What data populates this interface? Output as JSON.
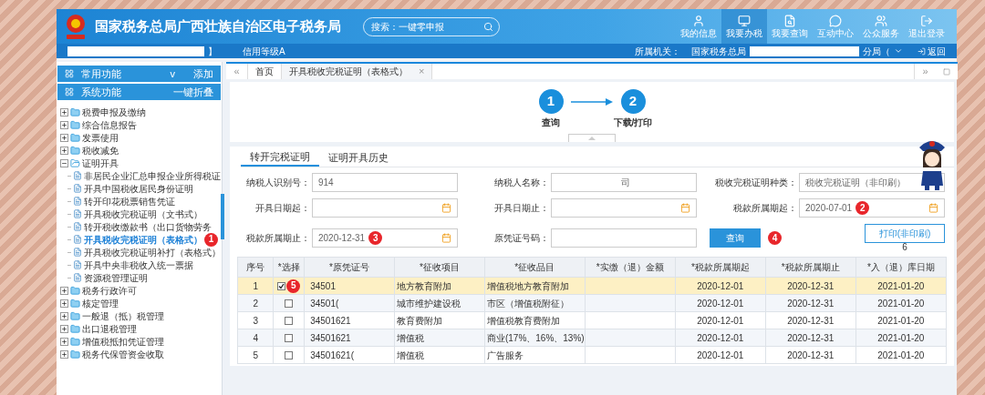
{
  "header": {
    "title": "国家税务总局广西壮族自治区电子税务局",
    "search_placeholder": "搜索：一键零申报",
    "nav": [
      {
        "kind": "user",
        "label": "我的信息",
        "selected": false
      },
      {
        "kind": "monitor",
        "label": "我要办税",
        "selected": true
      },
      {
        "kind": "search",
        "label": "我要查询",
        "selected": false
      },
      {
        "kind": "chat",
        "label": "互动中心",
        "selected": false
      },
      {
        "kind": "people",
        "label": "公众服务",
        "selected": false
      },
      {
        "kind": "logout",
        "label": "退出登录",
        "selected": false
      }
    ]
  },
  "subbar": {
    "bracket": "】",
    "credit": "信用等级A",
    "org_label": "所属机关：",
    "org": "国家税务总局",
    "org_suffix": "分局（",
    "back": "返回"
  },
  "sidebar": {
    "sections": [
      {
        "label": "常用功能",
        "caret": "v",
        "action": "添加"
      },
      {
        "label": "系统功能",
        "action": "一键折叠"
      }
    ],
    "tree": [
      {
        "label": "税费申报及缴纳",
        "expanded": false
      },
      {
        "label": "综合信息报告",
        "expanded": false
      },
      {
        "label": "发票使用",
        "expanded": false
      },
      {
        "label": "税收减免",
        "expanded": false
      },
      {
        "label": "证明开具",
        "expanded": true,
        "children": [
          {
            "label": "非居民企业汇总申报企业所得税证",
            "selected": false
          },
          {
            "label": "开具中国税收居民身份证明",
            "selected": false
          },
          {
            "label": "转开印花税票销售凭证",
            "selected": false
          },
          {
            "label": "开具税收完税证明（文书式）",
            "selected": false
          },
          {
            "label": "转开税收缴款书（出口货物劳务",
            "selected": false
          },
          {
            "label": "开具税收完税证明（表格式）",
            "selected": true,
            "callout": "1"
          },
          {
            "label": "开具税收完税证明补打（表格式）",
            "selected": false
          },
          {
            "label": "开具中央非税收入统一票据",
            "selected": false
          },
          {
            "label": "资源税管理证明",
            "selected": false
          }
        ]
      },
      {
        "label": "税务行政许可",
        "expanded": false
      },
      {
        "label": "核定管理",
        "expanded": false
      },
      {
        "label": "一般退（抵）税管理",
        "expanded": false
      },
      {
        "label": "出口退税管理",
        "expanded": false
      },
      {
        "label": "增值税抵扣凭证管理",
        "expanded": false
      },
      {
        "label": "税务代保管资金收取",
        "expanded": false
      }
    ]
  },
  "page_tabs": {
    "prev": "«",
    "next": "»",
    "tabs": [
      {
        "label": "首页",
        "selected": false,
        "closable": false
      },
      {
        "label": "开具税收完税证明（表格式）",
        "selected": true,
        "closable": true,
        "close": "×"
      }
    ]
  },
  "steps": [
    {
      "number": "1",
      "label": "查询"
    },
    {
      "number": "2",
      "label": "下载/打印"
    }
  ],
  "form": {
    "tabs": [
      {
        "label": "转开完税证明",
        "selected": true
      },
      {
        "label": "证明开具历史",
        "selected": false
      }
    ],
    "fields": [
      {
        "label": "纳税人识别号：",
        "value": "914",
        "date": false
      },
      {
        "label": "纳税人名称：",
        "suffix": "司",
        "date": false
      },
      {
        "label": "税收完税证明种类：",
        "value": "税收完税证明（非印刷）",
        "date": false
      },
      {
        "label": "开具日期起：",
        "date": true
      },
      {
        "label": "开具日期止：",
        "date": true
      },
      {
        "label": "税款所属期起：",
        "value": "2020-07-01",
        "date": true,
        "callout": "2"
      },
      {
        "label": "税款所属期止：",
        "value": "2020-12-31",
        "date": true,
        "callout": "3"
      },
      {
        "label": "原凭证号码：",
        "date": false
      }
    ],
    "query_button": {
      "label": "查询",
      "callout": "4"
    },
    "print_button": {
      "label": "打印(非印刷)",
      "note": "6"
    }
  },
  "table": {
    "columns": [
      "序号",
      "*选择",
      "*原凭证号",
      "*征收项目",
      "*征收品目",
      "*实缴（退）金额",
      "*税款所属期起",
      "*税款所属期止",
      "*入（退）库日期"
    ],
    "rows": [
      {
        "no": "1",
        "checked": true,
        "selected": true,
        "callout": "5",
        "voucher": "34501",
        "item": "地方教育附加",
        "subitem": "增值税地方教育附加",
        "start": "2020-12-01",
        "end": "2020-12-31",
        "date": "2021-01-20"
      },
      {
        "no": "2",
        "checked": false,
        "selected": false,
        "voucher": "34501(",
        "item": "城市维护建设税",
        "subitem": "市区（增值税附征）",
        "start": "2020-12-01",
        "end": "2020-12-31",
        "date": "2021-01-20"
      },
      {
        "no": "3",
        "checked": false,
        "selected": false,
        "voucher": "34501621",
        "item": "教育费附加",
        "subitem": "增值税教育费附加",
        "start": "2020-12-01",
        "end": "2020-12-31",
        "date": "2021-01-20"
      },
      {
        "no": "4",
        "checked": false,
        "selected": false,
        "voucher": "34501621",
        "item": "增值税",
        "subitem": "商业(17%、16%、13%)",
        "start": "2020-12-01",
        "end": "2020-12-31",
        "date": "2021-01-20"
      },
      {
        "no": "5",
        "checked": false,
        "selected": false,
        "voucher": "34501621(",
        "item": "增值税",
        "subitem": "广告服务",
        "start": "2020-12-01",
        "end": "2020-12-31",
        "date": "2021-01-20"
      }
    ]
  }
}
